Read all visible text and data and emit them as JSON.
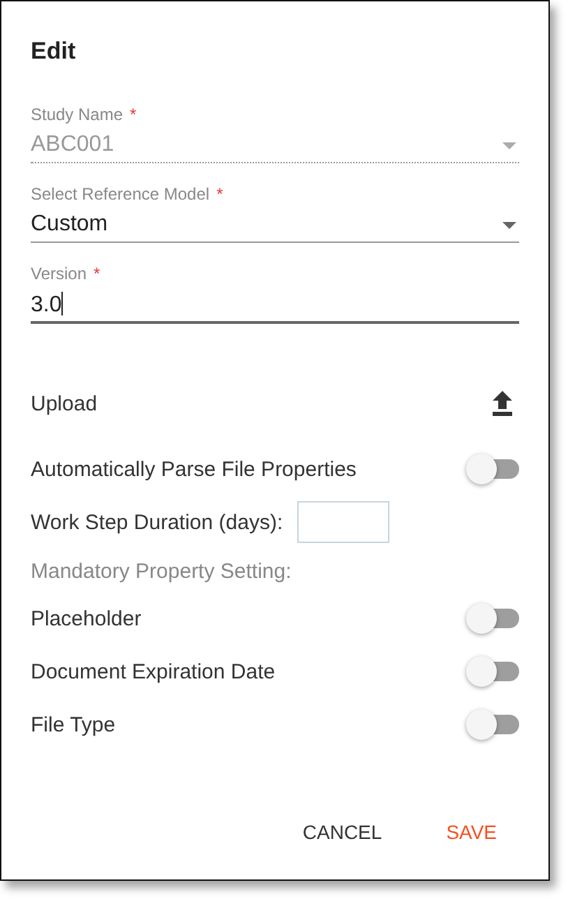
{
  "dialog": {
    "title": "Edit"
  },
  "fields": [
    {
      "kind": "select",
      "label": "Study Name",
      "required_mark": "*",
      "value": "ABC001",
      "disabled": true,
      "focused": false
    },
    {
      "kind": "select",
      "label": "Select Reference Model",
      "required_mark": "*",
      "value": "Custom",
      "disabled": false,
      "focused": false
    },
    {
      "kind": "input",
      "label": "Version",
      "required_mark": "*",
      "value": "3.0",
      "disabled": false,
      "focused": true
    }
  ],
  "upload": {
    "label": "Upload"
  },
  "parse_toggle": {
    "label": "Automatically Parse File Properties",
    "on": false
  },
  "work_step": {
    "label": "Work Step Duration (days):"
  },
  "mandatory_heading": "Mandatory Property Setting:",
  "mandatory_toggles": [
    {
      "label": "Placeholder",
      "on": false
    },
    {
      "label": "Document Expiration Date",
      "on": false
    },
    {
      "label": "File Type",
      "on": false
    }
  ],
  "buttons": [
    {
      "label": "CANCEL",
      "kind": "secondary"
    },
    {
      "label": "SAVE",
      "kind": "primary"
    }
  ]
}
